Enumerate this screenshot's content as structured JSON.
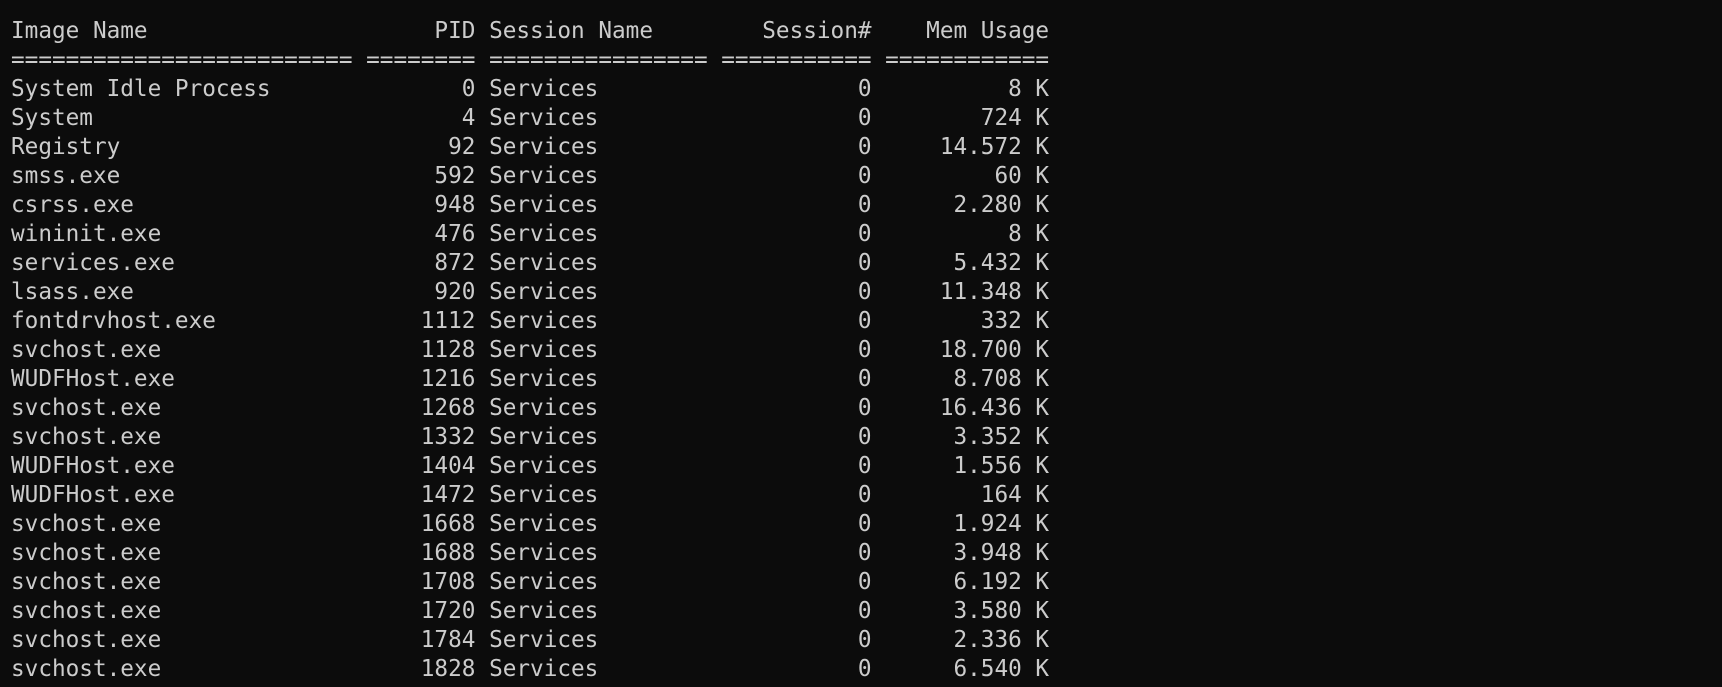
{
  "theme": {
    "background": "#0c0c0c",
    "foreground": "#cccccc"
  },
  "terminal": {
    "header": "Image Name                     PID Session Name        Session#    Mem Usage",
    "separator": "========================= ======== ================ =========== ============",
    "rows": [
      {
        "image_name": "System Idle Process",
        "pid": "0",
        "session_name": "Services",
        "session_num": "0",
        "mem_usage": "8 K"
      },
      {
        "image_name": "System",
        "pid": "4",
        "session_name": "Services",
        "session_num": "0",
        "mem_usage": "724 K"
      },
      {
        "image_name": "Registry",
        "pid": "92",
        "session_name": "Services",
        "session_num": "0",
        "mem_usage": "14.572 K"
      },
      {
        "image_name": "smss.exe",
        "pid": "592",
        "session_name": "Services",
        "session_num": "0",
        "mem_usage": "60 K"
      },
      {
        "image_name": "csrss.exe",
        "pid": "948",
        "session_name": "Services",
        "session_num": "0",
        "mem_usage": "2.280 K"
      },
      {
        "image_name": "wininit.exe",
        "pid": "476",
        "session_name": "Services",
        "session_num": "0",
        "mem_usage": "8 K"
      },
      {
        "image_name": "services.exe",
        "pid": "872",
        "session_name": "Services",
        "session_num": "0",
        "mem_usage": "5.432 K"
      },
      {
        "image_name": "lsass.exe",
        "pid": "920",
        "session_name": "Services",
        "session_num": "0",
        "mem_usage": "11.348 K"
      },
      {
        "image_name": "fontdrvhost.exe",
        "pid": "1112",
        "session_name": "Services",
        "session_num": "0",
        "mem_usage": "332 K"
      },
      {
        "image_name": "svchost.exe",
        "pid": "1128",
        "session_name": "Services",
        "session_num": "0",
        "mem_usage": "18.700 K"
      },
      {
        "image_name": "WUDFHost.exe",
        "pid": "1216",
        "session_name": "Services",
        "session_num": "0",
        "mem_usage": "8.708 K"
      },
      {
        "image_name": "svchost.exe",
        "pid": "1268",
        "session_name": "Services",
        "session_num": "0",
        "mem_usage": "16.436 K"
      },
      {
        "image_name": "svchost.exe",
        "pid": "1332",
        "session_name": "Services",
        "session_num": "0",
        "mem_usage": "3.352 K"
      },
      {
        "image_name": "WUDFHost.exe",
        "pid": "1404",
        "session_name": "Services",
        "session_num": "0",
        "mem_usage": "1.556 K"
      },
      {
        "image_name": "WUDFHost.exe",
        "pid": "1472",
        "session_name": "Services",
        "session_num": "0",
        "mem_usage": "164 K"
      },
      {
        "image_name": "svchost.exe",
        "pid": "1668",
        "session_name": "Services",
        "session_num": "0",
        "mem_usage": "1.924 K"
      },
      {
        "image_name": "svchost.exe",
        "pid": "1688",
        "session_name": "Services",
        "session_num": "0",
        "mem_usage": "3.948 K"
      },
      {
        "image_name": "svchost.exe",
        "pid": "1708",
        "session_name": "Services",
        "session_num": "0",
        "mem_usage": "6.192 K"
      },
      {
        "image_name": "svchost.exe",
        "pid": "1720",
        "session_name": "Services",
        "session_num": "0",
        "mem_usage": "3.580 K"
      },
      {
        "image_name": "svchost.exe",
        "pid": "1784",
        "session_name": "Services",
        "session_num": "0",
        "mem_usage": "2.336 K"
      },
      {
        "image_name": "svchost.exe",
        "pid": "1828",
        "session_name": "Services",
        "session_num": "0",
        "mem_usage": "6.540 K"
      }
    ]
  }
}
